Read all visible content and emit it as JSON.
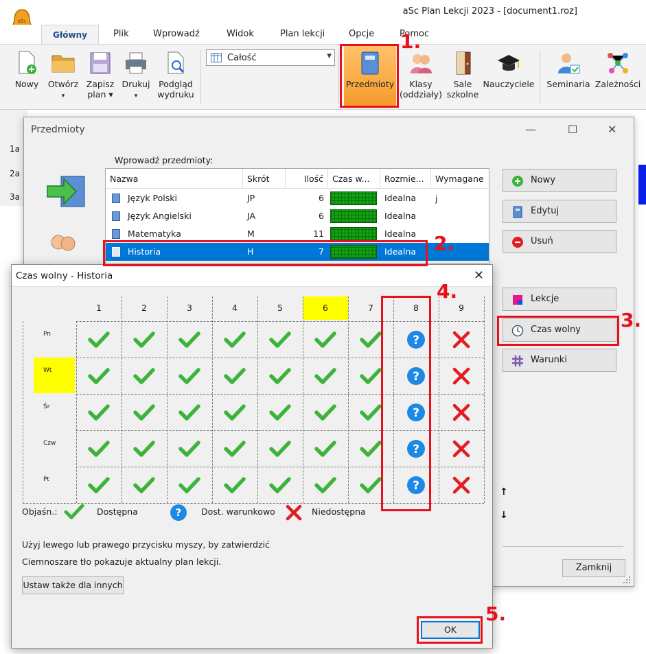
{
  "app": {
    "title": "aSc Plan Lekcji 2023 - [document1.roz]"
  },
  "tabs": [
    "Główny",
    "Plik",
    "Wprowadź",
    "Widok",
    "Plan lekcji",
    "Opcje",
    "Pomoc"
  ],
  "ribbon": {
    "buttons": [
      {
        "label": "Nowy",
        "sub": ""
      },
      {
        "label": "Otwórz",
        "sub": "▾"
      },
      {
        "label": "Zapisz",
        "sub": "plan ▾"
      },
      {
        "label": "Drukuj",
        "sub": "▾"
      },
      {
        "label": "Podgląd",
        "sub": "wydruku"
      },
      {
        "label": "Przedmioty",
        "sub": ""
      },
      {
        "label": "Klasy",
        "sub": "(oddziały)"
      },
      {
        "label": "Sale",
        "sub": "szkolne"
      },
      {
        "label": "Nauczyciele",
        "sub": ""
      },
      {
        "label": "Seminaria",
        "sub": ""
      },
      {
        "label": "Zależności",
        "sub": ""
      }
    ],
    "combo_value": "Całość"
  },
  "bg_rows": [
    "1a",
    "2a",
    "3a"
  ],
  "subjects_dialog": {
    "title": "Przedmioty",
    "enter_label": "Wprowadź przedmioty:",
    "columns": [
      "Nazwa",
      "Skrót",
      "Ilość",
      "Czas w...",
      "Rozmie...",
      "Wymagane j"
    ],
    "rows": [
      {
        "name": "Język Polski",
        "abbr": "JP",
        "count": "6",
        "placement": "Idealna"
      },
      {
        "name": "Język Angielski",
        "abbr": "JA",
        "count": "6",
        "placement": "Idealna"
      },
      {
        "name": "Matematyka",
        "abbr": "M",
        "count": "11",
        "placement": "Idealna"
      },
      {
        "name": "Historia",
        "abbr": "H",
        "count": "7",
        "placement": "Idealna"
      }
    ],
    "buttons": [
      "Nowy",
      "Edytuj",
      "Usuń",
      "Lekcje",
      "Czas wolny",
      "Warunki"
    ],
    "up_arrow": "↑",
    "down_arrow": "↓",
    "close_label": "Zamknij"
  },
  "free_time_dialog": {
    "title": "Czas wolny - Historia",
    "periods": [
      "1",
      "2",
      "3",
      "4",
      "5",
      "6",
      "7",
      "8",
      "9"
    ],
    "days": [
      "Pn",
      "Wt",
      "Śr",
      "Czw",
      "Pt"
    ],
    "cell_states": [
      "ok",
      "ok",
      "ok",
      "ok",
      "ok",
      "ok",
      "ok",
      "cond",
      "no"
    ],
    "legend": {
      "title": "Objaśn.:",
      "ok": "Dostępna",
      "cond": "Dost. warunkowo",
      "no": "Niedostępna"
    },
    "hint1": "Użyj lewego lub prawego przycisku myszy, by zatwierdzić",
    "hint2": "Ciemnoszare tło pokazuje aktualny plan lekcji.",
    "apply_others": "Ustaw także dla innych",
    "ok_label": "OK"
  },
  "steps": [
    "1.",
    "2.",
    "3.",
    "4.",
    "5."
  ],
  "colors": {
    "accent_red": "#e8101a",
    "select_blue": "#0078d7",
    "highlight_yellow": "#ffff00",
    "check_green": "#3cb43c",
    "cross_red": "#e31b23",
    "question_blue": "#1e88e5"
  }
}
